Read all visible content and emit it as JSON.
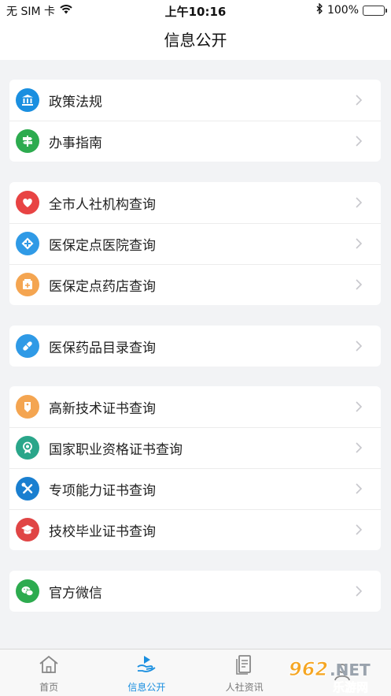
{
  "status_bar": {
    "carrier": "无 SIM 卡",
    "time": "上午10:16",
    "battery": "100%"
  },
  "nav": {
    "title": "信息公开"
  },
  "sections": [
    {
      "items": [
        {
          "label": "政策法规",
          "icon": "court-building-icon",
          "color": "#1a8fe0"
        },
        {
          "label": "办事指南",
          "icon": "signpost-icon",
          "color": "#2dab4f"
        }
      ]
    },
    {
      "items": [
        {
          "label": "全市人社机构查询",
          "icon": "heart-icon",
          "color": "#e84343"
        },
        {
          "label": "医保定点医院查询",
          "icon": "medical-cross-icon",
          "color": "#2f9ae6"
        },
        {
          "label": "医保定点药店查询",
          "icon": "pharmacy-icon",
          "color": "#f4a551"
        }
      ]
    },
    {
      "items": [
        {
          "label": "医保药品目录查询",
          "icon": "pill-icon",
          "color": "#2f9ae6"
        }
      ]
    },
    {
      "items": [
        {
          "label": "高新技术证书查询",
          "icon": "certificate-tag-icon",
          "color": "#f4a551"
        },
        {
          "label": "国家职业资格证书查询",
          "icon": "medal-icon",
          "color": "#2aa68a"
        },
        {
          "label": "专项能力证书查询",
          "icon": "tools-icon",
          "color": "#1a7fd0"
        },
        {
          "label": "技校毕业证书查询",
          "icon": "graduation-cap-icon",
          "color": "#e04545"
        }
      ]
    },
    {
      "items": [
        {
          "label": "官方微信",
          "icon": "wechat-icon",
          "color": "#2dab4f"
        }
      ]
    }
  ],
  "tabbar": {
    "tabs": [
      {
        "label": "首页",
        "icon": "home-icon"
      },
      {
        "label": "信息公开",
        "icon": "info-hand-icon"
      },
      {
        "label": "人社资讯",
        "icon": "news-doc-icon"
      },
      {
        "label": "",
        "icon": "profile-icon"
      }
    ]
  },
  "watermark": "962.NET 乐游网"
}
